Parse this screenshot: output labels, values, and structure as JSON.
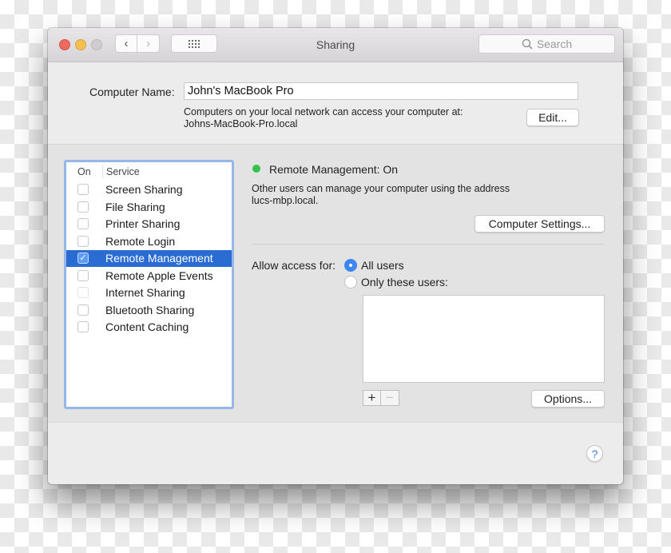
{
  "window": {
    "title": "Sharing",
    "search_placeholder": "Search"
  },
  "toolbar": {
    "back_icon": "‹",
    "forward_icon": "›"
  },
  "computer_name": {
    "label": "Computer Name:",
    "value": "John's MacBook Pro",
    "info_line1": "Computers on your local network can access your computer at:",
    "info_line2": "Johns-MacBook-Pro.local",
    "edit_button": "Edit..."
  },
  "services": {
    "header_on": "On",
    "header_service": "Service",
    "items": [
      {
        "name": "Screen Sharing",
        "enabled": false
      },
      {
        "name": "File Sharing",
        "enabled": false
      },
      {
        "name": "Printer Sharing",
        "enabled": false
      },
      {
        "name": "Remote Login",
        "enabled": false
      },
      {
        "name": "Remote Management",
        "enabled": true,
        "selected": true
      },
      {
        "name": "Remote Apple Events",
        "enabled": false
      },
      {
        "name": "Internet Sharing",
        "enabled": false,
        "disabled": true
      },
      {
        "name": "Bluetooth Sharing",
        "enabled": false
      },
      {
        "name": "Content Caching",
        "enabled": false
      }
    ]
  },
  "detail": {
    "status": "Remote Management: On",
    "status_color": "#35c24a",
    "description_line1": "Other users can manage your computer using the address",
    "description_line2": "lucs-mbp.local.",
    "computer_settings_button": "Computer Settings...",
    "allow_access_label": "Allow access for:",
    "options": [
      {
        "label": "All users",
        "selected": true
      },
      {
        "label": "Only these users:",
        "selected": false
      }
    ],
    "add_button": "+",
    "remove_button": "−",
    "options_button": "Options..."
  },
  "help_button": "?",
  "colors": {
    "selection": "#2a6cd2",
    "focus_ring": "#97b7ea",
    "radio_on": "#3c87f0"
  }
}
